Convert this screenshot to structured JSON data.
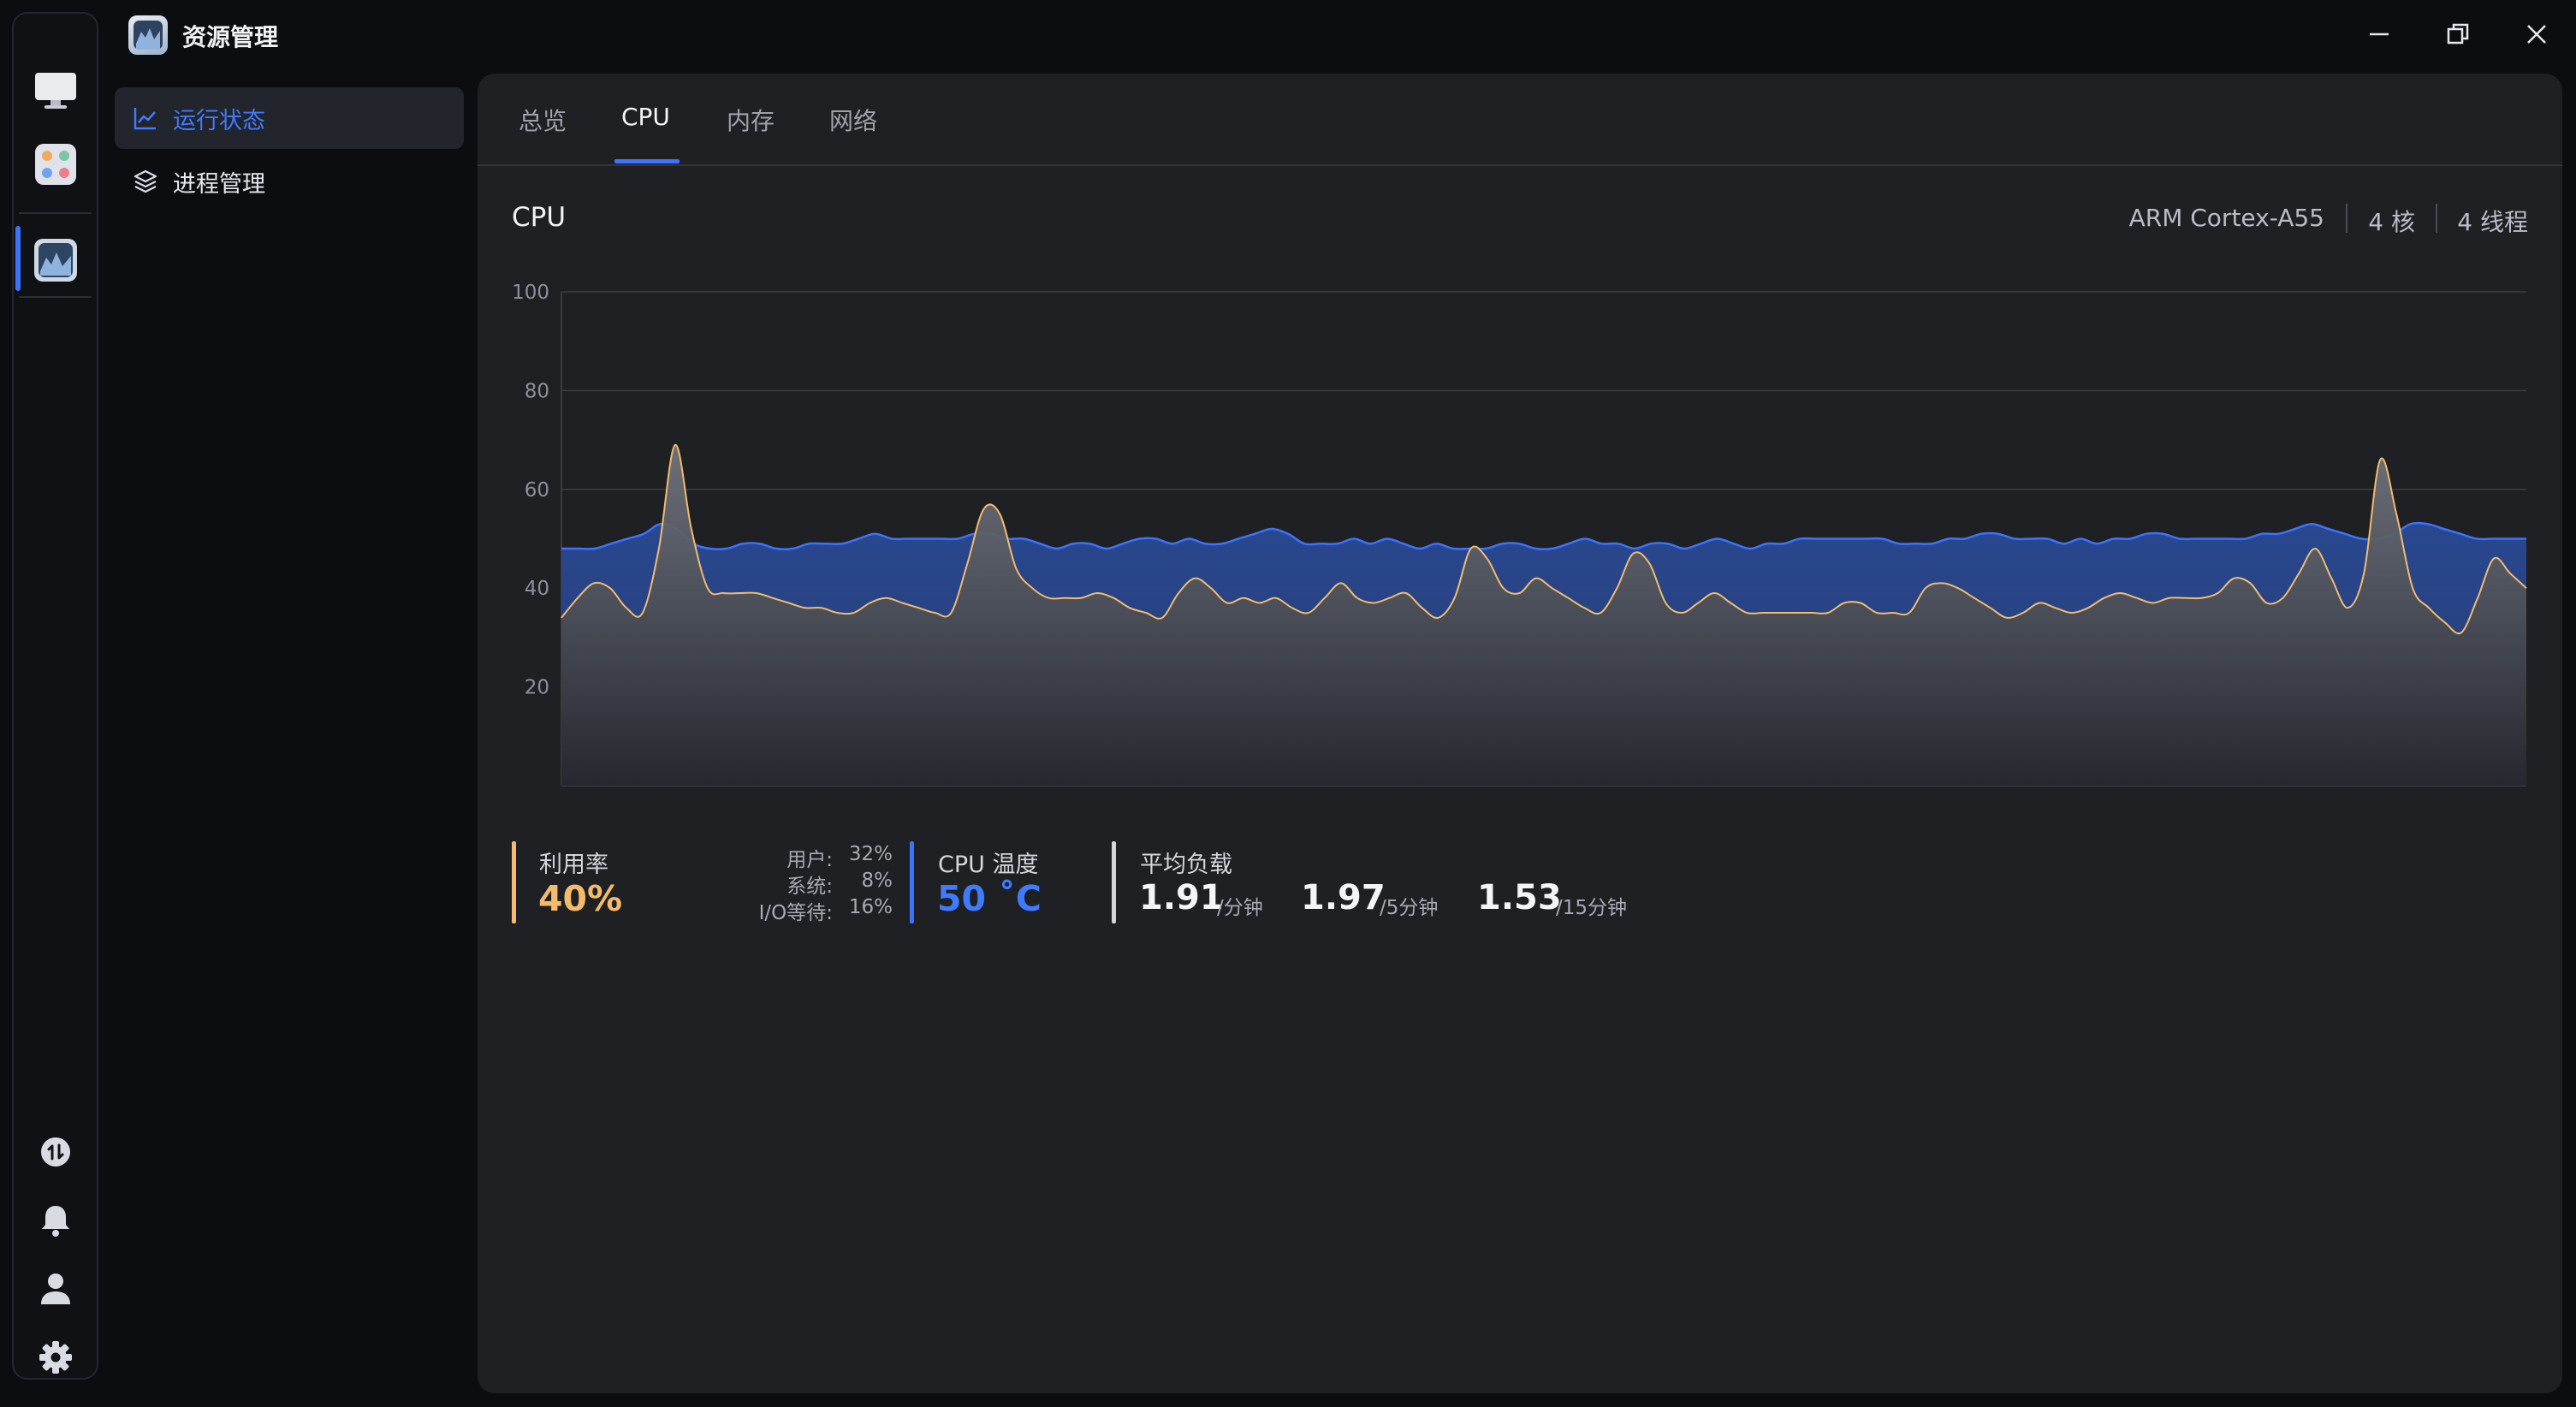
{
  "app": {
    "title": "资源管理"
  },
  "sidebar": {
    "items": [
      {
        "label": "运行状态",
        "active": true
      },
      {
        "label": "进程管理",
        "active": false
      }
    ]
  },
  "tabs": [
    {
      "label": "总览",
      "active": false
    },
    {
      "label": "CPU",
      "active": true
    },
    {
      "label": "内存",
      "active": false
    },
    {
      "label": "网络",
      "active": false
    }
  ],
  "cpu": {
    "section_title": "CPU",
    "model": "ARM Cortex-A55",
    "cores": "4 核",
    "threads": "4 线程"
  },
  "stats": {
    "usage": {
      "label": "利用率",
      "value": "40%",
      "user_label": "用户:",
      "user_value": "32%",
      "system_label": "系统:",
      "system_value": "8%",
      "io_label": "I/O等待:",
      "io_value": "16%"
    },
    "temperature": {
      "label": "CPU 温度",
      "value": "50 ˚C"
    },
    "load": {
      "label": "平均负载",
      "one": "1.91",
      "one_unit": "/分钟",
      "five": "1.97",
      "five_unit": "/5分钟",
      "fifteen": "1.53",
      "fifteen_unit": "/15分钟"
    }
  },
  "colors": {
    "accent_blue": "#3b73ff",
    "usage_orange": "#f3bb6a",
    "temp_blue": "#3f7bff",
    "panel_bg": "#1f2023"
  },
  "chart_data": {
    "type": "area",
    "ylim": [
      0,
      100
    ],
    "yticks": [
      "20",
      "40",
      "60",
      "80",
      "100"
    ],
    "grid": true,
    "series": [
      {
        "color": "#3b73ff",
        "values": [
          48,
          48,
          48,
          49,
          50,
          51,
          53,
          52,
          49,
          48,
          48,
          49,
          49,
          48,
          48,
          49,
          49,
          49,
          50,
          51,
          50,
          50,
          50,
          50,
          50,
          51,
          51,
          50,
          50,
          49,
          48,
          49,
          49,
          48,
          49,
          50,
          50,
          49,
          50,
          49,
          49,
          50,
          51,
          52,
          51,
          49,
          49,
          49,
          50,
          49,
          50,
          49,
          48,
          49,
          48,
          48,
          48,
          49,
          49,
          48,
          48,
          49,
          50,
          49,
          49,
          48,
          49,
          49,
          48,
          49,
          50,
          49,
          48,
          49,
          49,
          50,
          50,
          50,
          50,
          50,
          50,
          49,
          49,
          49,
          50,
          50,
          51,
          51,
          50,
          50,
          50,
          49,
          50,
          49,
          50,
          50,
          51,
          51,
          50,
          50,
          50,
          50,
          50,
          51,
          51,
          52,
          53,
          52,
          51,
          50,
          50,
          51,
          53,
          53,
          52,
          51,
          50,
          50,
          50,
          50
        ]
      },
      {
        "color": "#f3bb6a",
        "values": [
          34,
          38,
          41,
          40,
          36,
          35,
          48,
          69,
          52,
          40,
          39,
          39,
          39,
          38,
          37,
          36,
          36,
          35,
          35,
          37,
          38,
          37,
          36,
          35,
          35,
          45,
          56,
          55,
          44,
          40,
          38,
          38,
          38,
          39,
          38,
          36,
          35,
          34,
          39,
          42,
          40,
          37,
          38,
          37,
          38,
          36,
          35,
          38,
          41,
          38,
          37,
          38,
          39,
          36,
          34,
          38,
          48,
          46,
          40,
          39,
          42,
          40,
          38,
          36,
          35,
          40,
          47,
          45,
          37,
          35,
          37,
          39,
          37,
          35,
          35,
          35,
          35,
          35,
          35,
          37,
          37,
          35,
          35,
          35,
          40,
          41,
          40,
          38,
          36,
          34,
          35,
          37,
          36,
          35,
          36,
          38,
          39,
          38,
          37,
          38,
          38,
          38,
          39,
          42,
          41,
          37,
          38,
          43,
          48,
          42,
          36,
          43,
          66,
          55,
          40,
          36,
          33,
          31,
          38,
          46,
          43,
          40
        ]
      }
    ]
  }
}
